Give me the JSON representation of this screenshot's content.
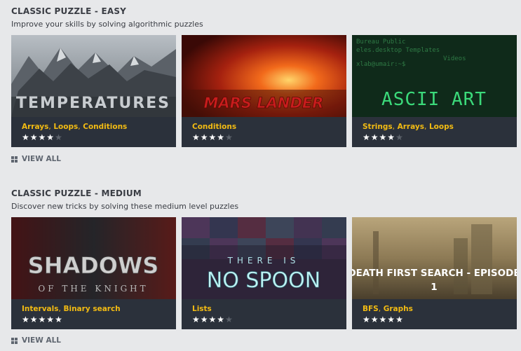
{
  "sections": [
    {
      "title": "CLASSIC PUZZLE - EASY",
      "subtitle": "Improve your skills by solving algorithmic puzzles",
      "view_all": "VIEW ALL",
      "cards": [
        {
          "image_text": "TEMPERATURES",
          "tags": [
            "Arrays",
            "Loops",
            "Conditions"
          ],
          "rating": 4,
          "max_rating": 5
        },
        {
          "image_text": "MARS LANDER",
          "tags": [
            "Conditions"
          ],
          "rating": 4,
          "max_rating": 5
        },
        {
          "image_text": "ASCII ART",
          "tags": [
            "Strings",
            "Arrays",
            "Loops"
          ],
          "rating": 4,
          "max_rating": 5
        }
      ]
    },
    {
      "title": "CLASSIC PUZZLE - MEDIUM",
      "subtitle": "Discover new tricks by solving these medium level puzzles",
      "view_all": "VIEW ALL",
      "cards": [
        {
          "image_text": "SHADOWS",
          "image_subtext": "OF THE KNIGHT",
          "tags": [
            "Intervals",
            "Binary search"
          ],
          "rating": 5,
          "max_rating": 5
        },
        {
          "image_text": "NO SPOON",
          "image_subtext": "THERE IS",
          "tags": [
            "Lists"
          ],
          "rating": 4,
          "max_rating": 5
        },
        {
          "image_text": "DEATH FIRST SEARCH - EPISODE",
          "image_subtext": "1",
          "tags": [
            "BFS",
            "Graphs"
          ],
          "rating": 5,
          "max_rating": 5
        }
      ]
    }
  ],
  "terminal_snippet": {
    "line1": "Bureau Public",
    "line2": "eles.desktop Templates",
    "line3": "Videos",
    "line4": "xlab@umair:~$"
  },
  "colors": {
    "background": "#e7e8ea",
    "card_info_bg": "#2b313b",
    "tag_color": "#f2bb13",
    "star_on": "#ffffff",
    "star_off": "#5d636c",
    "title_color": "#3a3d44",
    "view_all_color": "#5f6670"
  },
  "icons": {
    "view_all": "grid-icon",
    "star": "star-icon"
  }
}
